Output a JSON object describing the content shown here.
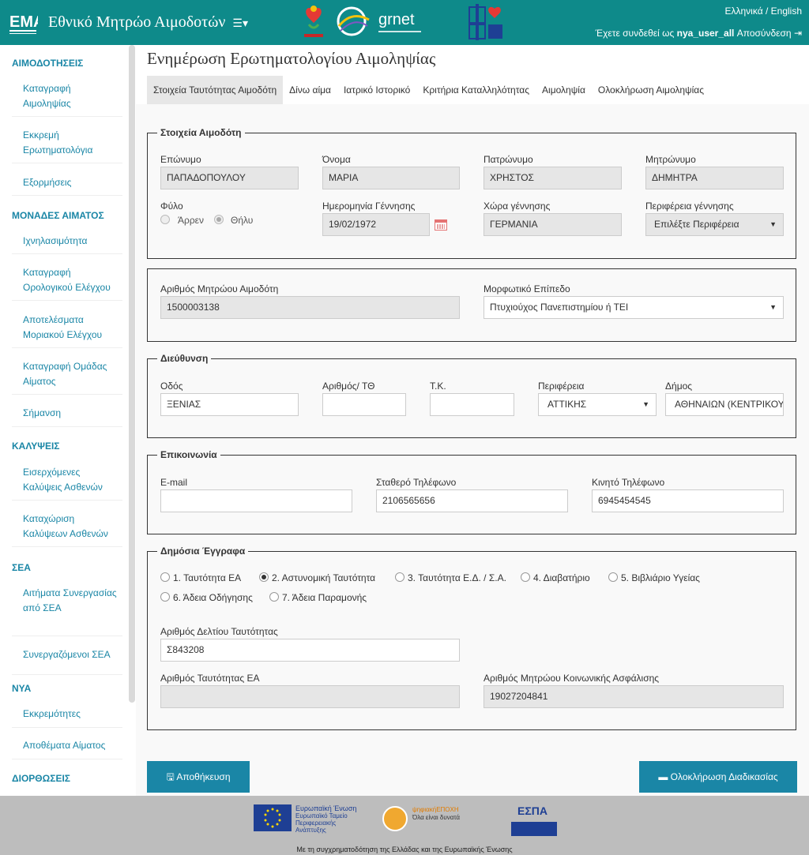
{
  "header": {
    "brand_title": "Εθνικό Μητρώο Αιμοδοτών",
    "lang_links": "Ελληνικά / English",
    "logged_in_prefix": "Έχετε συνδεθεί ως",
    "username": "nya_user_all",
    "logout_label": "Αποσύνδεση",
    "colors": {
      "header_bg": "#0e8a8a",
      "accent": "#1a86a6"
    }
  },
  "sidebar": {
    "sections": [
      {
        "title": "ΑΙΜΟΔΟΤΗΣΕΙΣ",
        "items": [
          "Καταγραφή Αιμοληψίας",
          "Εκκρεμή Ερωτηματολόγια",
          "Εξορμήσεις"
        ]
      },
      {
        "title": "ΜΟΝΑΔΕΣ ΑΙΜΑΤΟΣ",
        "items": [
          "Ιχνηλασιμότητα",
          "Καταγραφή Ορολογικού Ελέγχου",
          "Αποτελέσματα Μοριακού Ελέγχου",
          "Καταγραφή Ομάδας Αίματος",
          "Σήμανση"
        ]
      },
      {
        "title": "ΚΑΛΥΨΕΙΣ",
        "items": [
          "Εισερχόμενες Καλύψεις Ασθενών",
          "Καταχώριση Καλύψεων Ασθενών"
        ]
      },
      {
        "title": "ΣΕΑ",
        "items": [
          "Αιτήματα Συνεργασίας από ΣΕΑ",
          "Συνεργαζόμενοι ΣΕΑ"
        ]
      },
      {
        "title": "ΝΥΑ",
        "items": [
          "Εκκρεμότητες",
          "Αποθέματα Αίματος"
        ]
      },
      {
        "title": "ΔΙΟΡΘΩΣΕΙΣ",
        "items": []
      }
    ]
  },
  "page": {
    "title": "Ενημέρωση Ερωτηματολογίου Αιμοληψίας",
    "tabs": [
      "Στοιχεία Ταυτότητας Αιμοδότη",
      "Δίνω αίμα",
      "Ιατρικό Ιστορικό",
      "Κριτήρια Καταλληλότητας",
      "Αιμοληψία",
      "Ολοκλήρωση Αιμοληψίας"
    ],
    "active_tab": "Στοιχεία Ταυτότητας Αιμοδότη"
  },
  "donor": {
    "legend": "Στοιχεία Αιμοδότη",
    "surname_label": "Επώνυμο",
    "surname": "ΠΑΠΑΔΟΠΟΥΛΟΥ",
    "name_label": "Όνομα",
    "name": "ΜΑΡΙΑ",
    "father_label": "Πατρώνυμο",
    "father": "ΧΡΗΣΤΟΣ",
    "mother_label": "Μητρώνυμο",
    "mother": "ΔΗΜΗΤΡΑ",
    "gender_label": "Φύλο",
    "gender_male": "Άρρεν",
    "gender_female": "Θήλυ",
    "gender_selected": "Θήλυ",
    "dob_label": "Ημερομηνία Γέννησης",
    "dob": "19/02/1972",
    "birth_country_label": "Χώρα γέννησης",
    "birth_country": "ΓΕΡΜΑΝΙΑ",
    "birth_region_label": "Περιφέρεια γέννησης",
    "birth_region": "Επιλέξτε Περιφέρεια"
  },
  "registry": {
    "number_label": "Αριθμός Μητρώου Αιμοδότη",
    "number": "1500003138",
    "education_label": "Μορφωτικό Επίπεδο",
    "education": "Πτυχιούχος Πανεπιστημίου ή ΤΕΙ"
  },
  "address": {
    "legend": "Διεύθυνση",
    "street_label": "Οδός",
    "street": "ΞΕΝΙΑΣ",
    "number_label": "Αριθμός/ ΤΘ",
    "number": "",
    "zip_label": "Τ.Κ.",
    "zip": "",
    "region_label": "Περιφέρεια",
    "region": "ΑΤΤΙΚΗΣ",
    "municipality_label": "Δήμος",
    "municipality": "ΑΘΗΝΑΙΩΝ (ΚΕΝΤΡΙΚΟΥ"
  },
  "contact": {
    "legend": "Επικοινωνία",
    "email_label": "E-mail",
    "email": "",
    "landline_label": "Σταθερό Τηλέφωνο",
    "landline": "2106565656",
    "mobile_label": "Κινητό Τηλέφωνο",
    "mobile": "6945454545"
  },
  "documents": {
    "legend": "Δημόσια Έγγραφα",
    "options": [
      "1. Ταυτότητα ΕΑ",
      "2. Αστυνομική Ταυτότητα",
      "3. Ταυτότητα Ε.Δ. / Σ.Α.",
      "4. Διαβατήριο",
      "5. Βιβλιάριο Υγείας",
      "6. Άδεια Οδήγησης",
      "7. Άδεια Παραμονής"
    ],
    "selected": "2. Αστυνομική Ταυτότητα",
    "id_number_label": "Αριθμός Δελτίου Ταυτότητας",
    "id_number": "Σ843208",
    "eu_id_label": "Αριθμός Ταυτότητας ΕΑ",
    "eu_id": "",
    "amka_label": "Αριθμός Μητρώου Κοινωνικής Ασφάλισης",
    "amka": "19027204841"
  },
  "actions": {
    "save_label": "Αποθήκευση",
    "complete_label": "Ολοκλήρωση Διαδικασίας"
  },
  "footer": {
    "cofinance_text": "Με τη συγχρηματοδότηση της Ελλάδας και της Ευρωπαϊκής Ένωσης",
    "eu_text": "Ευρωπαϊκή Ένωση",
    "eu_sub": "Ευρωπαϊκό Ταμείο Περιφερειακής Ανάπτυξης",
    "ps_text": "ψηφιακήΕΠΟΧΗ",
    "ps_sub": "Όλα είναι δυνατά",
    "espa_text": "ΕΣΠΑ"
  }
}
